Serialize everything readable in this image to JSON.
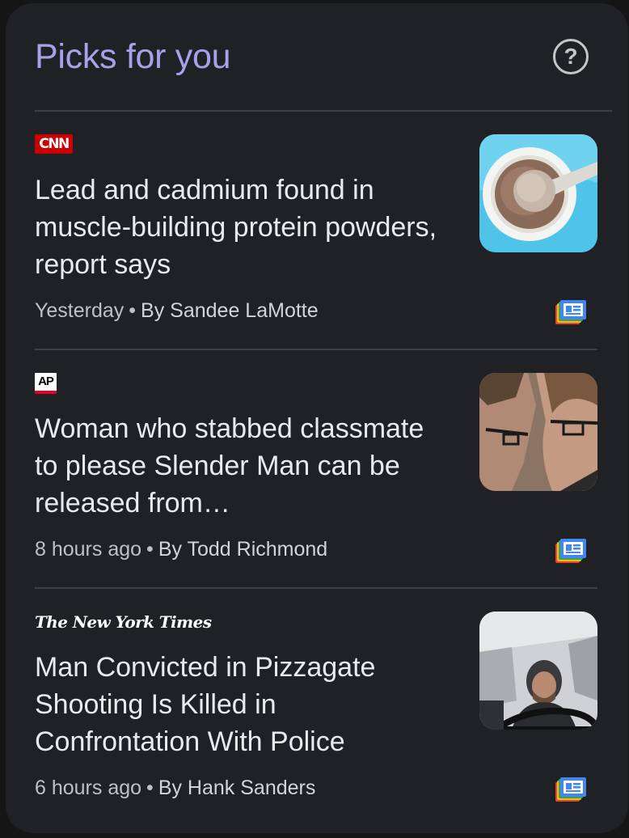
{
  "header": {
    "title": "Picks for you",
    "help_label": "?"
  },
  "stories": [
    {
      "source": "CNN",
      "source_logo": "cnn-logo",
      "headline": "Lead and cadmium found in muscle-building protein powders, report says",
      "time": "Yesterday",
      "separator": "•",
      "author": "By Sandee LaMotte",
      "thumbnail": "protein-powder-scoop-image"
    },
    {
      "source": "AP",
      "source_logo": "ap-logo",
      "headline": "Woman who stabbed classmate to please Slender Man can be released from…",
      "time": "8 hours ago",
      "separator": "•",
      "author": "By Todd Richmond",
      "thumbnail": "courtroom-profile-image"
    },
    {
      "source": "The New York Times",
      "source_logo": "nyt-logo",
      "headline": "Man Convicted in Pizzagate Shooting Is Killed in Confrontation With Police",
      "time": "6 hours ago",
      "separator": "•",
      "author": "By Hank Sanders",
      "thumbnail": "man-in-car-image"
    }
  ],
  "colors": {
    "background": "#202124",
    "title": "#a8a0e8",
    "headline": "#e8eaed",
    "meta": "#bdc1c6",
    "divider": "#3c4043"
  },
  "icons": {
    "help": "help-circle-icon",
    "news": "google-news-icon"
  }
}
